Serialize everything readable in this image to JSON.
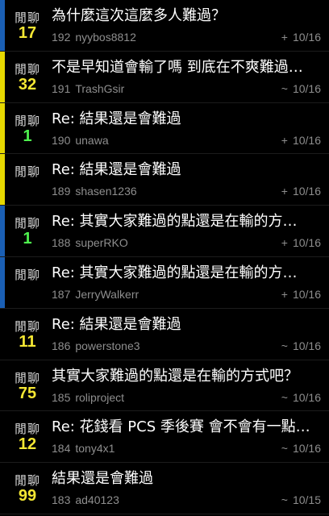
{
  "colors": {
    "background": "#000000",
    "count_yellow": "#f4e733",
    "count_green": "#4ef04e",
    "bar_blue": "#1a5fb4",
    "bar_yellow": "#e6d800",
    "meta_gray": "#8e8e8e"
  },
  "posts": [
    {
      "category": "閒聊",
      "count": "17",
      "count_color": "yellow",
      "bar": "blue",
      "title": "為什麼這次這麼多人難過？",
      "number": "192",
      "author": "nyybos8812",
      "mark": "+",
      "date": "10/16"
    },
    {
      "category": "閒聊",
      "count": "32",
      "count_color": "yellow",
      "bar": "yellow",
      "title": "不是早知道會輸了嗎 到底在不爽難過…",
      "number": "191",
      "author": "TrashGsir",
      "mark": "~",
      "date": "10/16"
    },
    {
      "category": "閒聊",
      "count": "1",
      "count_color": "green",
      "bar": "yellow",
      "title": "Re: 結果還是會難過",
      "number": "190",
      "author": "unawa",
      "mark": "+",
      "date": "10/16"
    },
    {
      "category": "閒聊",
      "count": "",
      "count_color": "yellow",
      "bar": "yellow",
      "title": "Re: 結果還是會難過",
      "number": "189",
      "author": "shasen1236",
      "mark": "+",
      "date": "10/16"
    },
    {
      "category": "閒聊",
      "count": "1",
      "count_color": "green",
      "bar": "blue",
      "title": "Re: 其實大家難過的點還是在輸的方…",
      "number": "188",
      "author": "superRKO",
      "mark": "+",
      "date": "10/16"
    },
    {
      "category": "閒聊",
      "count": "",
      "count_color": "yellow",
      "bar": "blue",
      "title": "Re: 其實大家難過的點還是在輸的方…",
      "number": "187",
      "author": "JerryWalkerr",
      "mark": "+",
      "date": "10/16"
    },
    {
      "category": "閒聊",
      "count": "11",
      "count_color": "yellow",
      "bar": "none",
      "title": "Re: 結果還是會難過",
      "number": "186",
      "author": "powerstone3",
      "mark": "~",
      "date": "10/16"
    },
    {
      "category": "閒聊",
      "count": "75",
      "count_color": "yellow",
      "bar": "none",
      "title": "其實大家難過的點還是在輸的方式吧？",
      "number": "185",
      "author": "roliproject",
      "mark": "~",
      "date": "10/16"
    },
    {
      "category": "閒聊",
      "count": "12",
      "count_color": "yellow",
      "bar": "none",
      "title": "Re: 花錢看 PCS 季後賽 會不會有一點…",
      "number": "184",
      "author": "tony4x1",
      "mark": "~",
      "date": "10/16"
    },
    {
      "category": "閒聊",
      "count": "99",
      "count_color": "yellow",
      "bar": "none",
      "title": "結果還是會難過",
      "number": "183",
      "author": "ad40123",
      "mark": "~",
      "date": "10/15"
    }
  ]
}
